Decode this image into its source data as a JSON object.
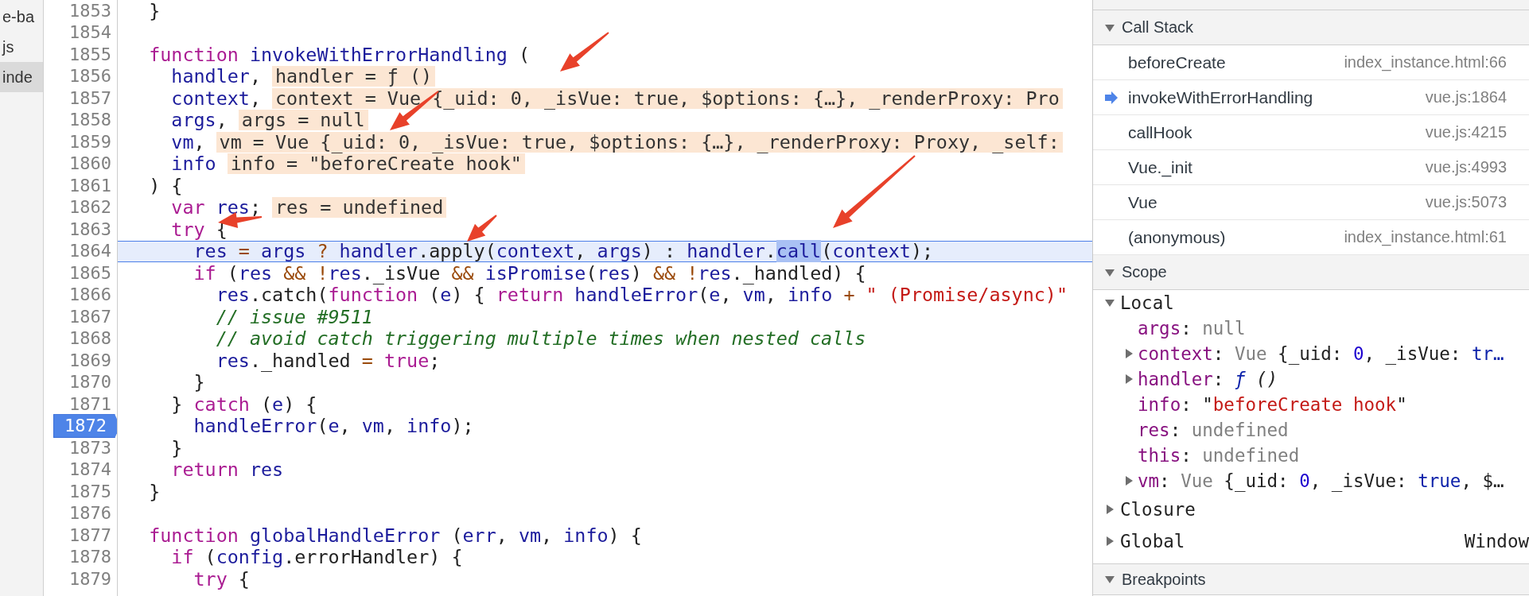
{
  "file_sidebar": {
    "items": [
      {
        "label": "e-ba",
        "selected": false
      },
      {
        "label": "js",
        "selected": false
      },
      {
        "label": "inde",
        "selected": true
      }
    ]
  },
  "editor": {
    "lines": [
      {
        "number": "1853",
        "current": false,
        "breakpoint": false,
        "tokens": [
          {
            "kind": "plain",
            "text": "  }"
          }
        ]
      },
      {
        "number": "1854",
        "current": false,
        "breakpoint": false
      },
      {
        "number": "1855",
        "current": false,
        "breakpoint": false,
        "tokens": [
          {
            "kind": "keyword",
            "text": "  function "
          },
          {
            "kind": "name",
            "text": "invokeWithErrorHandling"
          },
          {
            "kind": "plain",
            "text": " ("
          }
        ]
      },
      {
        "number": "1856",
        "current": false,
        "breakpoint": false,
        "tokens": [
          {
            "kind": "name",
            "text": "    handler"
          },
          {
            "kind": "plain",
            "text": ","
          }
        ],
        "inline_value": "handler = ƒ ()"
      },
      {
        "number": "1857",
        "current": false,
        "breakpoint": false,
        "tokens": [
          {
            "kind": "name",
            "text": "    context"
          },
          {
            "kind": "plain",
            "text": ","
          }
        ],
        "inline_value": "context = Vue {_uid: 0, _isVue: true, $options: {…}, _renderProxy: Pro"
      },
      {
        "number": "1858",
        "current": false,
        "breakpoint": false,
        "tokens": [
          {
            "kind": "name",
            "text": "    args"
          },
          {
            "kind": "plain",
            "text": ","
          }
        ],
        "inline_value": "args = null"
      },
      {
        "number": "1859",
        "current": false,
        "breakpoint": false,
        "tokens": [
          {
            "kind": "name",
            "text": "    vm"
          },
          {
            "kind": "plain",
            "text": ","
          }
        ],
        "inline_value": "vm = Vue {_uid: 0, _isVue: true, $options: {…}, _renderProxy: Proxy, _self:"
      },
      {
        "number": "1860",
        "current": false,
        "breakpoint": false,
        "tokens": [
          {
            "kind": "name",
            "text": "    info"
          }
        ],
        "inline_value": "info = \"beforeCreate hook\""
      },
      {
        "number": "1861",
        "current": false,
        "breakpoint": false,
        "tokens": [
          {
            "kind": "plain",
            "text": "  ) {"
          }
        ]
      },
      {
        "number": "1862",
        "current": false,
        "breakpoint": false,
        "tokens": [
          {
            "kind": "keyword",
            "text": "    var "
          },
          {
            "kind": "name",
            "text": "res"
          },
          {
            "kind": "plain",
            "text": ";"
          }
        ],
        "inline_value": "res = undefined"
      },
      {
        "number": "1863",
        "current": false,
        "breakpoint": false,
        "tokens": [
          {
            "kind": "keyword",
            "text": "    try"
          },
          {
            "kind": "plain",
            "text": " {"
          }
        ]
      },
      {
        "number": "1864",
        "current": true,
        "breakpoint": false,
        "tokens": [
          {
            "kind": "name",
            "text": "      res "
          },
          {
            "kind": "operator",
            "text": "= "
          },
          {
            "kind": "name",
            "text": "args "
          },
          {
            "kind": "operator",
            "text": "? "
          },
          {
            "kind": "name",
            "text": "handler"
          },
          {
            "kind": "plain",
            "text": ".apply("
          },
          {
            "kind": "name",
            "text": "context"
          },
          {
            "kind": "plain",
            "text": ", "
          },
          {
            "kind": "name",
            "text": "args"
          },
          {
            "kind": "plain",
            "text": ") : "
          },
          {
            "kind": "name",
            "text": "handler"
          },
          {
            "kind": "plain",
            "text": "."
          },
          {
            "kind": "selection",
            "text": "call"
          },
          {
            "kind": "plain",
            "text": "("
          },
          {
            "kind": "name",
            "text": "context"
          },
          {
            "kind": "plain",
            "text": ");"
          }
        ]
      },
      {
        "number": "1865",
        "current": false,
        "breakpoint": false,
        "tokens": [
          {
            "kind": "keyword",
            "text": "      if"
          },
          {
            "kind": "plain",
            "text": " ("
          },
          {
            "kind": "name",
            "text": "res "
          },
          {
            "kind": "operator",
            "text": "&& !"
          },
          {
            "kind": "name",
            "text": "res"
          },
          {
            "kind": "plain",
            "text": "._isVue "
          },
          {
            "kind": "operator",
            "text": "&& "
          },
          {
            "kind": "name",
            "text": "isPromise"
          },
          {
            "kind": "plain",
            "text": "("
          },
          {
            "kind": "name",
            "text": "res"
          },
          {
            "kind": "plain",
            "text": ") "
          },
          {
            "kind": "operator",
            "text": "&& !"
          },
          {
            "kind": "name",
            "text": "res"
          },
          {
            "kind": "plain",
            "text": "._handled) {"
          }
        ]
      },
      {
        "number": "1866",
        "current": false,
        "breakpoint": false,
        "tokens": [
          {
            "kind": "name",
            "text": "        res"
          },
          {
            "kind": "plain",
            "text": ".catch("
          },
          {
            "kind": "keyword",
            "text": "function"
          },
          {
            "kind": "plain",
            "text": " ("
          },
          {
            "kind": "name",
            "text": "e"
          },
          {
            "kind": "plain",
            "text": ") { "
          },
          {
            "kind": "keyword",
            "text": "return "
          },
          {
            "kind": "name",
            "text": "handleError"
          },
          {
            "kind": "plain",
            "text": "("
          },
          {
            "kind": "name",
            "text": "e"
          },
          {
            "kind": "plain",
            "text": ", "
          },
          {
            "kind": "name",
            "text": "vm"
          },
          {
            "kind": "plain",
            "text": ", "
          },
          {
            "kind": "name",
            "text": "info "
          },
          {
            "kind": "operator",
            "text": "+ "
          },
          {
            "kind": "string",
            "text": "\" (Promise/async)\""
          }
        ]
      },
      {
        "number": "1867",
        "current": false,
        "breakpoint": false,
        "tokens": [
          {
            "kind": "comment",
            "text": "        // issue #9511"
          }
        ]
      },
      {
        "number": "1868",
        "current": false,
        "breakpoint": false,
        "tokens": [
          {
            "kind": "comment",
            "text": "        // avoid catch triggering multiple times when nested calls"
          }
        ]
      },
      {
        "number": "1869",
        "current": false,
        "breakpoint": false,
        "tokens": [
          {
            "kind": "name",
            "text": "        res"
          },
          {
            "kind": "plain",
            "text": "._handled "
          },
          {
            "kind": "operator",
            "text": "= "
          },
          {
            "kind": "keyword",
            "text": "true"
          },
          {
            "kind": "plain",
            "text": ";"
          }
        ]
      },
      {
        "number": "1870",
        "current": false,
        "breakpoint": false,
        "tokens": [
          {
            "kind": "plain",
            "text": "      }"
          }
        ]
      },
      {
        "number": "1871",
        "current": false,
        "breakpoint": false,
        "tokens": [
          {
            "kind": "plain",
            "text": "    } "
          },
          {
            "kind": "keyword",
            "text": "catch"
          },
          {
            "kind": "plain",
            "text": " ("
          },
          {
            "kind": "name",
            "text": "e"
          },
          {
            "kind": "plain",
            "text": ") {"
          }
        ]
      },
      {
        "number": "1872",
        "current": false,
        "breakpoint": true,
        "tokens": [
          {
            "kind": "name",
            "text": "      handleError"
          },
          {
            "kind": "plain",
            "text": "("
          },
          {
            "kind": "name",
            "text": "e"
          },
          {
            "kind": "plain",
            "text": ", "
          },
          {
            "kind": "name",
            "text": "vm"
          },
          {
            "kind": "plain",
            "text": ", "
          },
          {
            "kind": "name",
            "text": "info"
          },
          {
            "kind": "plain",
            "text": ");"
          }
        ]
      },
      {
        "number": "1873",
        "current": false,
        "breakpoint": false,
        "tokens": [
          {
            "kind": "plain",
            "text": "    }"
          }
        ]
      },
      {
        "number": "1874",
        "current": false,
        "breakpoint": false,
        "tokens": [
          {
            "kind": "keyword",
            "text": "    return "
          },
          {
            "kind": "name",
            "text": "res"
          }
        ]
      },
      {
        "number": "1875",
        "current": false,
        "breakpoint": false,
        "tokens": [
          {
            "kind": "plain",
            "text": "  }"
          }
        ]
      },
      {
        "number": "1876",
        "current": false,
        "breakpoint": false
      },
      {
        "number": "1877",
        "current": false,
        "breakpoint": false,
        "tokens": [
          {
            "kind": "keyword",
            "text": "  function "
          },
          {
            "kind": "name",
            "text": "globalHandleError"
          },
          {
            "kind": "plain",
            "text": " ("
          },
          {
            "kind": "name",
            "text": "err"
          },
          {
            "kind": "plain",
            "text": ", "
          },
          {
            "kind": "name",
            "text": "vm"
          },
          {
            "kind": "plain",
            "text": ", "
          },
          {
            "kind": "name",
            "text": "info"
          },
          {
            "kind": "plain",
            "text": ") {"
          }
        ]
      },
      {
        "number": "1878",
        "current": false,
        "breakpoint": false,
        "tokens": [
          {
            "kind": "keyword",
            "text": "    if"
          },
          {
            "kind": "plain",
            "text": " ("
          },
          {
            "kind": "name",
            "text": "config"
          },
          {
            "kind": "plain",
            "text": ".errorHandler) {"
          }
        ]
      },
      {
        "number": "1879",
        "current": false,
        "breakpoint": false,
        "tokens": [
          {
            "kind": "keyword",
            "text": "      try"
          },
          {
            "kind": "plain",
            "text": " {"
          }
        ]
      }
    ]
  },
  "call_stack": {
    "title": "Call Stack",
    "expanded": true,
    "frames": [
      {
        "name": "beforeCreate",
        "location": "index_instance.html:66",
        "selected": false
      },
      {
        "name": "invokeWithErrorHandling",
        "location": "vue.js:1864",
        "selected": true
      },
      {
        "name": "callHook",
        "location": "vue.js:4215",
        "selected": false
      },
      {
        "name": "Vue._init",
        "location": "vue.js:4993",
        "selected": false
      },
      {
        "name": "Vue",
        "location": "vue.js:5073",
        "selected": false
      },
      {
        "name": "(anonymous)",
        "location": "index_instance.html:61",
        "selected": false
      }
    ]
  },
  "scope": {
    "title": "Scope",
    "expanded": true,
    "groups": [
      {
        "title": "Local",
        "expanded": true,
        "items": [
          {
            "kind": "primitive",
            "parts": [
              {
                "kind": "prop",
                "text": "args"
              },
              {
                "kind": "plain",
                "text": ": "
              },
              {
                "kind": "dim",
                "text": "null"
              }
            ]
          },
          {
            "kind": "object",
            "expanded": false,
            "parts": [
              {
                "kind": "prop",
                "text": "context"
              },
              {
                "kind": "plain",
                "text": ": "
              },
              {
                "kind": "dim",
                "text": "Vue"
              },
              {
                "kind": "plain",
                "text": " {_uid: "
              },
              {
                "kind": "number",
                "text": "0"
              },
              {
                "kind": "plain",
                "text": ", _isVue: "
              },
              {
                "kind": "keyword",
                "text": "tr…"
              }
            ]
          },
          {
            "kind": "object",
            "expanded": false,
            "parts": [
              {
                "kind": "prop",
                "text": "handler"
              },
              {
                "kind": "plain",
                "text": ": "
              },
              {
                "kind": "func",
                "text": "ƒ"
              },
              {
                "kind": "italic",
                "text": " ()"
              }
            ]
          },
          {
            "kind": "primitive",
            "parts": [
              {
                "kind": "prop",
                "text": "info"
              },
              {
                "kind": "plain",
                "text": ": \""
              },
              {
                "kind": "string",
                "text": "beforeCreate hook"
              },
              {
                "kind": "plain",
                "text": "\""
              }
            ]
          },
          {
            "kind": "primitive",
            "parts": [
              {
                "kind": "prop",
                "text": "res"
              },
              {
                "kind": "plain",
                "text": ": "
              },
              {
                "kind": "dim",
                "text": "undefined"
              }
            ]
          },
          {
            "kind": "primitive",
            "parts": [
              {
                "kind": "prop",
                "text": "this"
              },
              {
                "kind": "plain",
                "text": ": "
              },
              {
                "kind": "dim",
                "text": "undefined"
              }
            ]
          },
          {
            "kind": "object",
            "expanded": false,
            "parts": [
              {
                "kind": "prop",
                "text": "vm"
              },
              {
                "kind": "plain",
                "text": ": "
              },
              {
                "kind": "dim",
                "text": "Vue"
              },
              {
                "kind": "plain",
                "text": " {_uid: "
              },
              {
                "kind": "number",
                "text": "0"
              },
              {
                "kind": "plain",
                "text": ", _isVue: "
              },
              {
                "kind": "keyword",
                "text": "true"
              },
              {
                "kind": "plain",
                "text": ", $…"
              }
            ]
          }
        ]
      },
      {
        "title": "Closure",
        "expanded": false
      },
      {
        "title": "Global",
        "expanded": false,
        "value": "Window"
      }
    ]
  },
  "breakpoints": {
    "title": "Breakpoints",
    "expanded": true
  }
}
